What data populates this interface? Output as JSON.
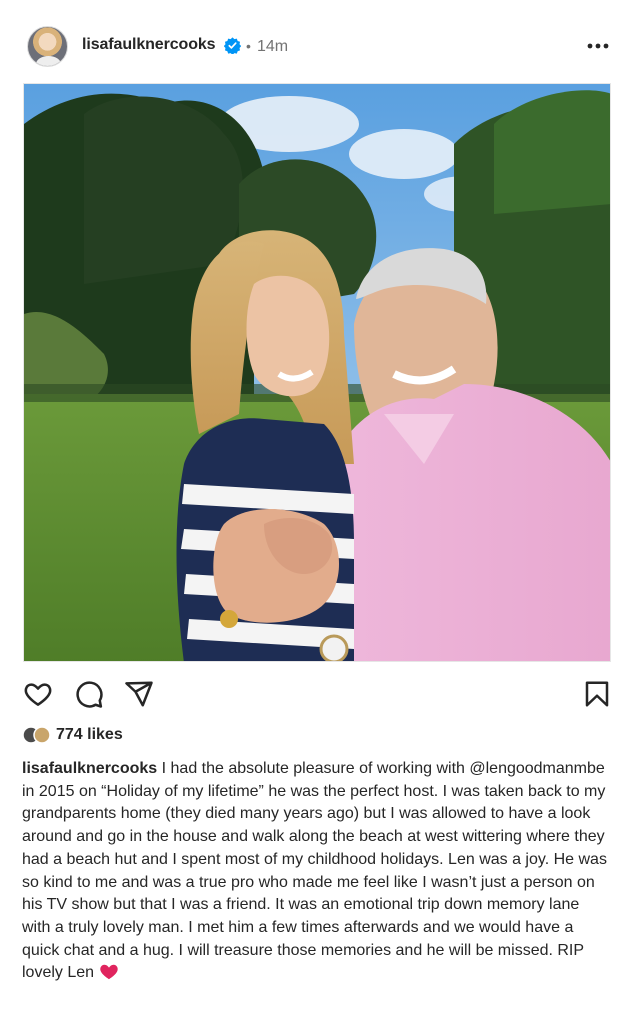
{
  "post": {
    "username": "lisafaulknercooks",
    "separator": "•",
    "time": "14m",
    "likes": "774 likes",
    "caption_text": "I had the absolute pleasure of working with @lengoodmanmbe in 2015 on “Holiday of my lifetime” he was the perfect host. I was taken back to my grandparents home (they died many years ago) but I was allowed to have a look around and go in the house and walk along the beach at west wittering where they had a beach hut and I spent most of my childhood holidays. Len was a joy. He was so kind to me and was a true pro who made me feel like I wasn’t just a person on his TV show but that I was a friend. It was an emotional trip down memory lane with a truly lovely man. I met him a few times afterwards and we would have a quick chat and a hug. I will treasure those memories and he will be missed. RIP lovely Len"
  },
  "icons": {
    "verified": "verified-badge-icon",
    "more": "more-options-icon",
    "like": "heart-icon",
    "comment": "comment-icon",
    "share": "share-icon",
    "save": "bookmark-icon",
    "caption_end": "red-heart-emoji-icon"
  },
  "colors": {
    "verified": "#0095f6",
    "text": "#262626",
    "secondary": "#737373",
    "heart": "#e0245e"
  }
}
